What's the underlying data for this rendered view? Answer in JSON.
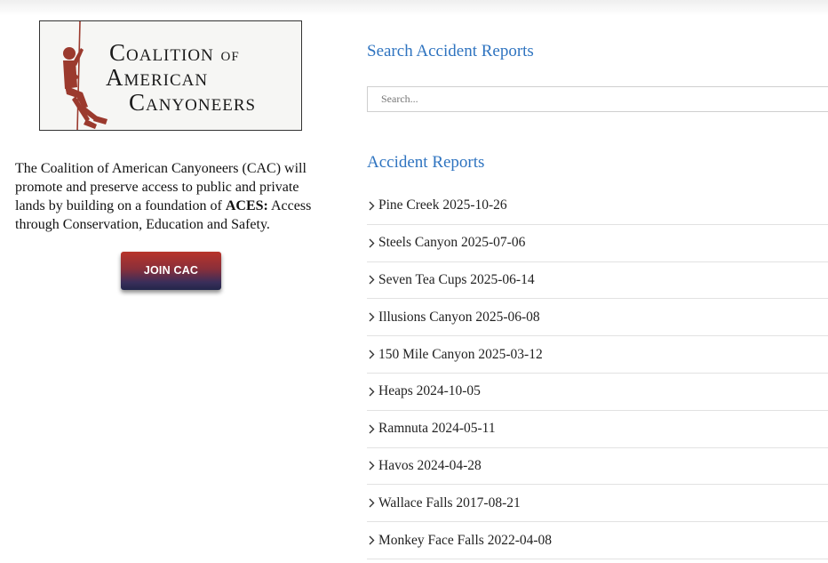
{
  "logo": {
    "line1": "Coalition",
    "line1_of": "of",
    "line2": "American",
    "line3": "Canyoneers",
    "colors": {
      "climber": "#9b3a2e",
      "text": "#1a1a1a"
    }
  },
  "mission": {
    "part1": "The Coalition of American Canyoneers (CAC) will promote and preserve access to public and private lands by building on a foundation of ",
    "acronym": "ACES:",
    "part2": " Access through Conservation, Education and Safety."
  },
  "join_button": {
    "label": "JOIN CAC"
  },
  "search": {
    "heading": "Search Accident Reports",
    "placeholder": "Search..."
  },
  "reports": {
    "heading": "Accident Reports",
    "items": [
      {
        "label": "Pine Creek 2025-10-26"
      },
      {
        "label": "Steels Canyon 2025-07-06"
      },
      {
        "label": "Seven Tea Cups 2025-06-14"
      },
      {
        "label": "Illusions Canyon 2025-06-08"
      },
      {
        "label": "150 Mile Canyon 2025-03-12"
      },
      {
        "label": "Heaps 2024-10-05"
      },
      {
        "label": "Ramnuta 2024-05-11"
      },
      {
        "label": "Havos 2024-04-28"
      },
      {
        "label": "Wallace Falls 2017-08-21"
      },
      {
        "label": "Monkey Face Falls 2022-04-08"
      }
    ]
  },
  "theme": {
    "heading_color": "#2f74c0",
    "button_gradient_top": "#b8342a",
    "button_gradient_bottom": "#22264a"
  },
  "icons": {
    "list_bullet": "chevron-right-icon",
    "logo_figure": "rappelling-climber-icon"
  }
}
